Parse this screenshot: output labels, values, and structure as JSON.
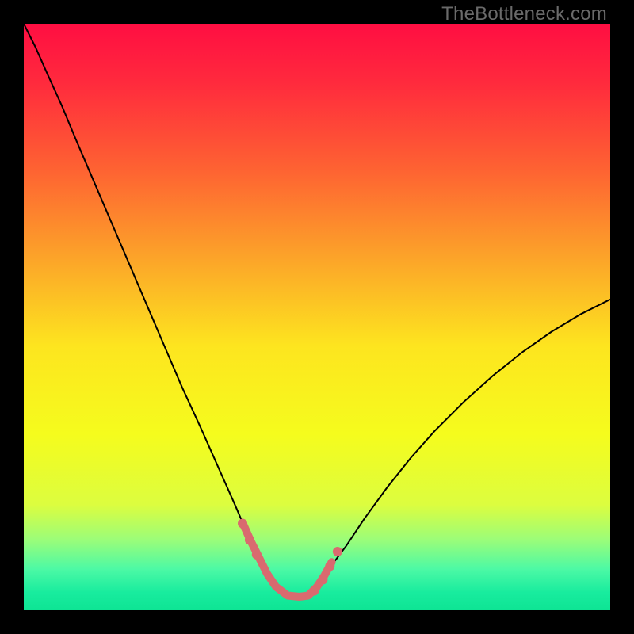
{
  "watermark": "TheBottleneck.com",
  "chart_data": {
    "type": "line",
    "title": "",
    "xlabel": "",
    "ylabel": "",
    "xlim": [
      0,
      100
    ],
    "ylim": [
      0,
      100
    ],
    "gradient_stops": [
      {
        "offset": 0.0,
        "color": "#ff0e42"
      },
      {
        "offset": 0.1,
        "color": "#ff2a3d"
      },
      {
        "offset": 0.25,
        "color": "#fe6332"
      },
      {
        "offset": 0.4,
        "color": "#fca429"
      },
      {
        "offset": 0.55,
        "color": "#fde51f"
      },
      {
        "offset": 0.7,
        "color": "#f5fc1d"
      },
      {
        "offset": 0.82,
        "color": "#dcfd3f"
      },
      {
        "offset": 0.88,
        "color": "#9bfd79"
      },
      {
        "offset": 0.93,
        "color": "#4cf9a5"
      },
      {
        "offset": 0.97,
        "color": "#18ec9e"
      },
      {
        "offset": 1.0,
        "color": "#0ee494"
      }
    ],
    "series": [
      {
        "name": "bottleneck-curve",
        "stroke": "#000000",
        "stroke_width": 2,
        "x": [
          0.0,
          2.0,
          4.0,
          6.5,
          9.0,
          12.0,
          15.0,
          18.0,
          21.0,
          24.0,
          27.0,
          30.0,
          32.0,
          34.0,
          36.0,
          37.5,
          39.0,
          41.0,
          43.0,
          45.0,
          47.0,
          48.5,
          50.0,
          52.0,
          55.0,
          58.0,
          62.0,
          66.0,
          70.0,
          75.0,
          80.0,
          85.0,
          90.0,
          95.0,
          100.0
        ],
        "y": [
          100.0,
          96.0,
          91.5,
          86.0,
          80.0,
          73.0,
          66.0,
          59.0,
          52.0,
          45.0,
          38.0,
          31.5,
          27.0,
          22.5,
          18.0,
          14.5,
          11.0,
          7.0,
          4.0,
          2.5,
          2.3,
          2.5,
          4.0,
          7.0,
          11.0,
          15.5,
          21.0,
          26.0,
          30.5,
          35.5,
          40.0,
          44.0,
          47.5,
          50.5,
          53.0
        ]
      },
      {
        "name": "bottom-highlight",
        "stroke": "#d96a6f",
        "stroke_width": 10,
        "linecap": "round",
        "x": [
          37.5,
          38.7,
          40.0,
          41.5,
          43.0,
          45.0,
          47.0,
          48.5,
          50.0,
          51.2,
          52.5
        ],
        "y": [
          14.5,
          11.8,
          9.2,
          6.2,
          4.0,
          2.5,
          2.3,
          2.5,
          4.0,
          5.8,
          8.2
        ]
      }
    ],
    "highlight_dots": {
      "stroke": "#d96a6f",
      "radius": 6,
      "x": [
        37.3,
        38.5,
        39.7,
        49.5,
        51.0,
        52.2,
        53.5
      ],
      "y": [
        14.8,
        12.0,
        9.5,
        3.3,
        5.2,
        7.5,
        10.0
      ]
    }
  }
}
